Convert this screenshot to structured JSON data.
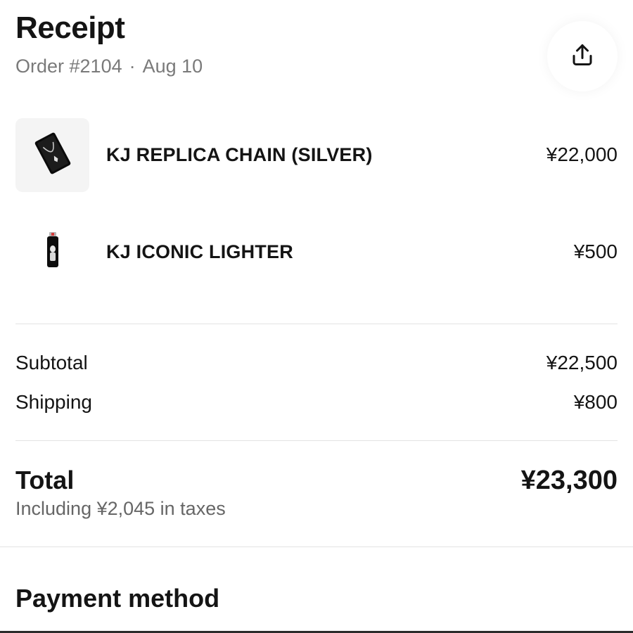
{
  "header": {
    "title": "Receipt",
    "order_number": "Order #2104",
    "separator": "·",
    "date": "Aug 10",
    "share_icon": "share-upload-icon"
  },
  "items": [
    {
      "name": "KJ REPLICA CHAIN (SILVER)",
      "price": "¥22,000",
      "thumbnail_icon": "chain-in-box-icon"
    },
    {
      "name": "KJ ICONIC LIGHTER",
      "price": "¥500",
      "thumbnail_icon": "lighter-icon"
    }
  ],
  "summary": {
    "subtotal_label": "Subtotal",
    "subtotal_value": "¥22,500",
    "shipping_label": "Shipping",
    "shipping_value": "¥800"
  },
  "total": {
    "label": "Total",
    "value": "¥23,300",
    "tax_note": "Including ¥2,045 in taxes"
  },
  "payment": {
    "heading": "Payment method"
  },
  "colors": {
    "text": "#141414",
    "muted": "#7a7a7a",
    "divider": "#e3e3e3"
  }
}
